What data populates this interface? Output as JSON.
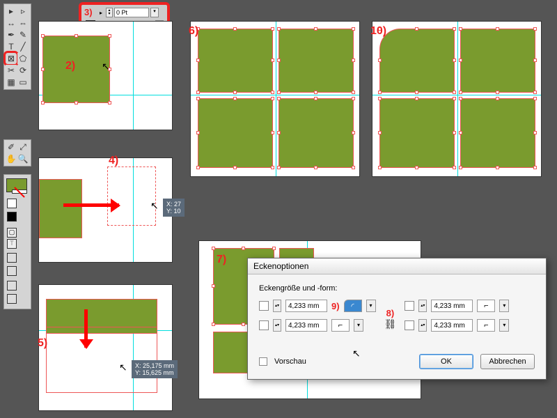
{
  "labels": {
    "n2": "2)",
    "n3": "3)",
    "n4": "4)",
    "n5": "5)",
    "n6": "6)",
    "n7": "7)",
    "n8": "8)",
    "n9": "9)",
    "n10": "10)"
  },
  "control_bar": {
    "stroke_value": "0 Pt"
  },
  "tooltip4": {
    "x": "X: 27",
    "y": "Y: 10"
  },
  "tooltip5": {
    "x": "X: 25,175 mm",
    "y": "Y: 15,625 mm"
  },
  "dialog": {
    "title": "Eckenoptionen",
    "group_label": "Eckengröße und -form:",
    "tl": "4,233 mm",
    "tr": "4,233 mm",
    "bl": "4,233 mm",
    "br": "4,233 mm",
    "preview": "Vorschau",
    "ok": "OK",
    "cancel": "Abbrechen"
  }
}
